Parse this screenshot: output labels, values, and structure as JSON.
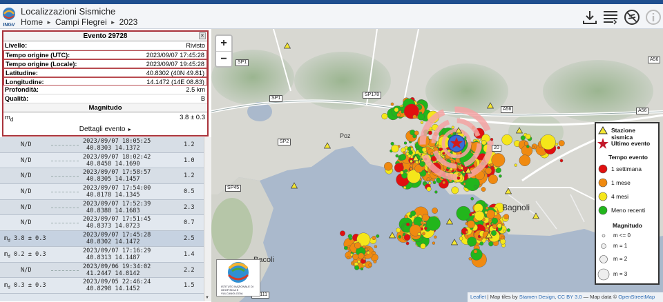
{
  "header": {
    "title": "Localizzazioni Sismiche",
    "breadcrumbs": [
      "Home",
      "Campi Flegrei",
      "2023"
    ],
    "logo_text": "INGV"
  },
  "toolbar": {
    "icons": [
      "download-icon",
      "list-icon",
      "no-layers-icon",
      "info-icon"
    ]
  },
  "event": {
    "title": "Evento 29728",
    "rows": [
      {
        "k": "Livello:",
        "v": "Rivisto"
      },
      {
        "k": "Tempo origine (UTC):",
        "v": "2023/09/07 17:45:28"
      },
      {
        "k": "Tempo origine (Locale):",
        "v": "2023/09/07 19:45:28"
      },
      {
        "k": "Latitudine:",
        "v": "40.8302 (40N 49.81)"
      },
      {
        "k": "Longitudine:",
        "v": "14.1472 (14E 08.83)"
      },
      {
        "k": "Profondità:",
        "v": "2.5 km"
      },
      {
        "k": "Qualità:",
        "v": "B"
      }
    ],
    "magnitude_title": "Magnitudo",
    "magnitude_label": "m",
    "magnitude_sub": "d",
    "magnitude_value": "3.8 ± 0.3",
    "details_label": "Dettagli evento"
  },
  "events": [
    {
      "m": "N/D",
      "date": "2023/09/07 18:05:25",
      "coords": "40.8303 14.1372",
      "val": "1.2"
    },
    {
      "m": "N/D",
      "date": "2023/09/07 18:02:42",
      "coords": "40.8458 14.1690",
      "val": "1.0"
    },
    {
      "m": "N/D",
      "date": "2023/09/07 17:58:57",
      "coords": "40.8305 14.1457",
      "val": "1.2"
    },
    {
      "m": "N/D",
      "date": "2023/09/07 17:54:00",
      "coords": "40.8178 14.1345",
      "val": "0.5"
    },
    {
      "m": "N/D",
      "date": "2023/09/07 17:52:39",
      "coords": "40.8388 14.1683",
      "val": "2.3"
    },
    {
      "m": "N/D",
      "date": "2023/09/07 17:51:45",
      "coords": "40.8373 14.0723",
      "val": "0.7"
    },
    {
      "m": "3.8 ± 0.3",
      "date": "2023/09/07 17:45:28",
      "coords": "40.8302 14.1472",
      "val": "2.5"
    },
    {
      "m": "0.2 ± 0.3",
      "date": "2023/09/07 17:16:29",
      "coords": "40.8313 14.1487",
      "val": "1.4"
    },
    {
      "m": "N/D",
      "date": "2023/09/06 19:34:02",
      "coords": "41.2447 14.8142",
      "val": "2.2"
    },
    {
      "m": "0.3 ± 0.3",
      "date": "2023/09/05 22:46:24",
      "coords": "40.8298 14.1452",
      "val": "1.5"
    }
  ],
  "map": {
    "zoom_in": "+",
    "zoom_out": "−",
    "roads": [
      "SP1",
      "SP1",
      "SP178",
      "A56",
      "A56",
      "A56",
      "SP2",
      "SP45",
      "SP111",
      "20"
    ],
    "places": [
      "Bagnoli",
      "Bacoli",
      "Poz"
    ],
    "attribution": [
      "Leaflet",
      "| Map tiles by",
      "Stamen Design",
      ",",
      "CC BY 3.0",
      "— Map data ©",
      "OpenStreetMap"
    ],
    "logo_caption": "ISTITUTO NAZIONALE DI GEOFISICA E VULCANOLOGIA",
    "colors": {
      "recent": "#e01010",
      "month": "#f08a10",
      "months4": "#f5e61a",
      "old": "#22b61c"
    }
  },
  "legend": {
    "station": "Stazione sismica",
    "last": "Ultimo evento",
    "time_title": "Tempo evento",
    "times": [
      "1 settimana",
      "1 mese",
      "4 mesi",
      "Meno recenti"
    ],
    "mag_title": "Magnitudo",
    "mags": [
      "m <= 0",
      "m = 1",
      "m = 2",
      "m = 3"
    ]
  }
}
